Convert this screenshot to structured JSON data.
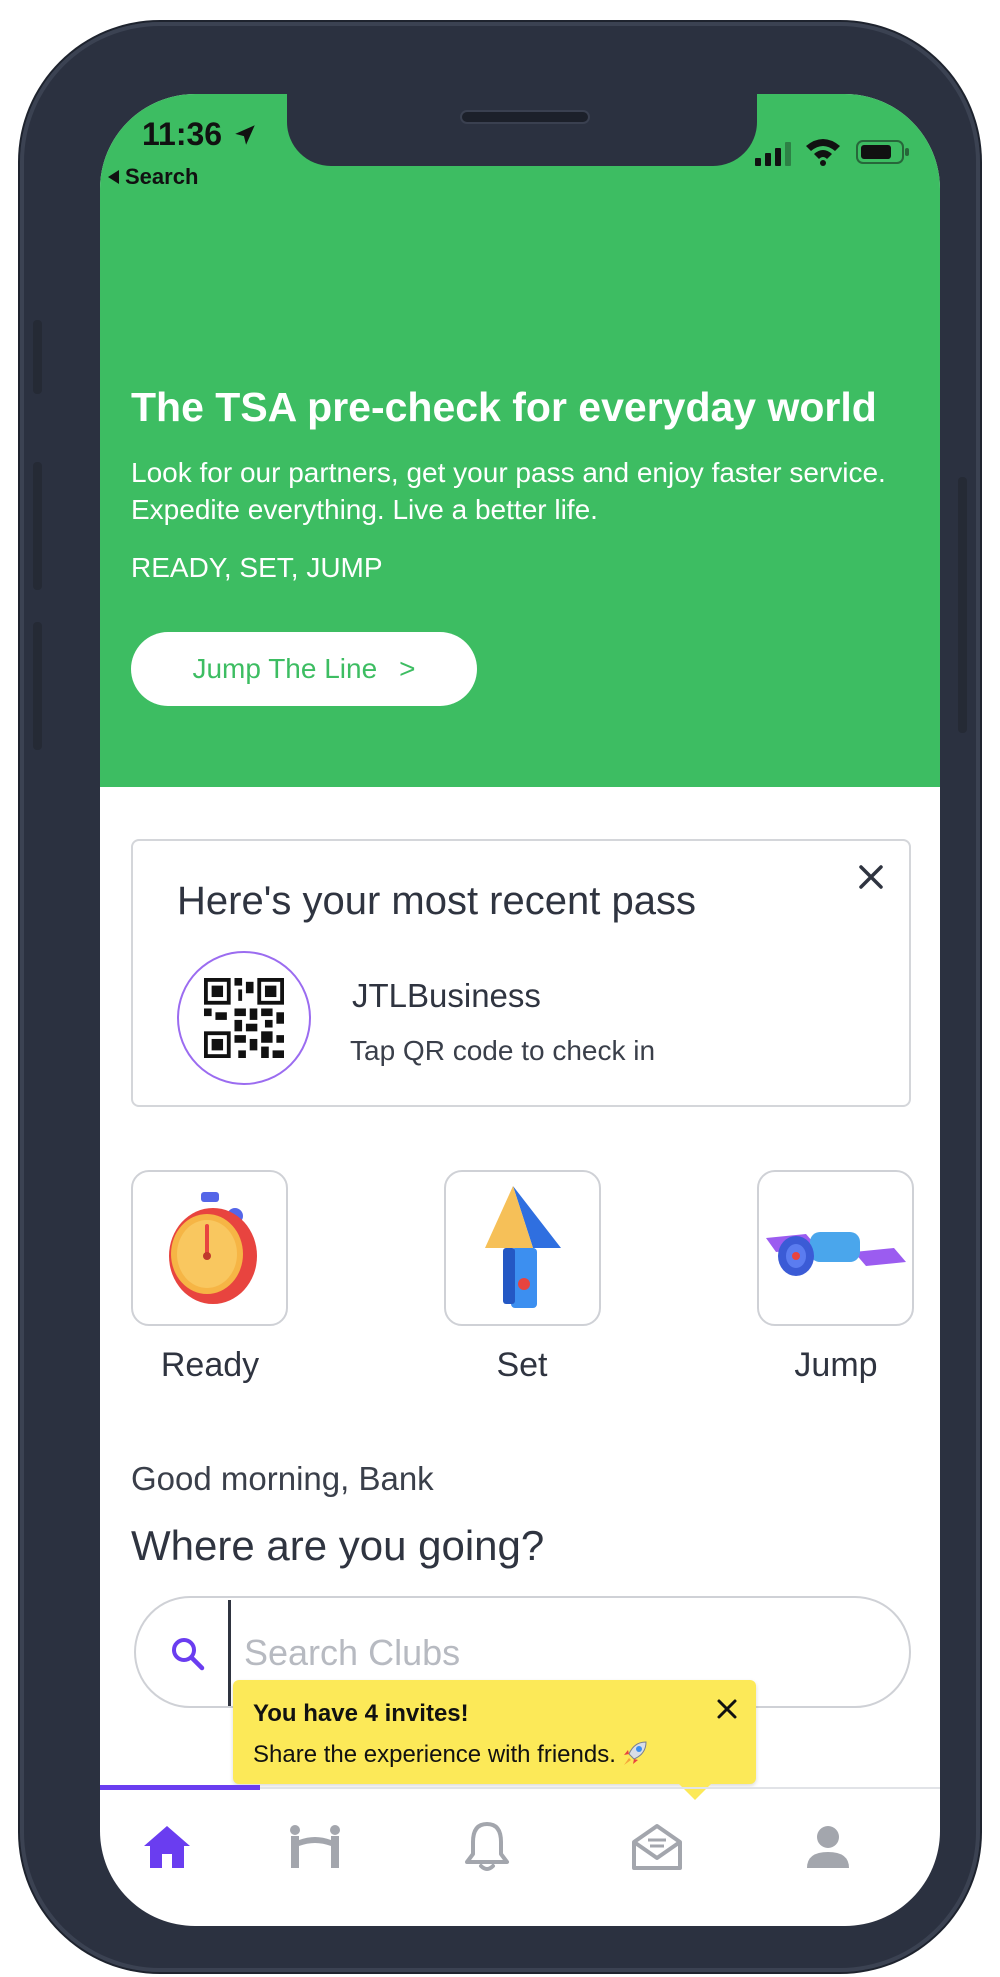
{
  "status_bar": {
    "time": "11:36",
    "back_label": "Search"
  },
  "hero": {
    "title": "The TSA pre-check for everyday world",
    "description": "Look for our partners, get your pass and enjoy faster service. Expedite everything. Live a better life.",
    "tagline": "READY, SET, JUMP",
    "cta_label": "Jump The Line",
    "cta_chevron": ">",
    "background_color": "#3dbd62"
  },
  "recent_pass": {
    "heading": "Here's your most recent pass",
    "name": "JTLBusiness",
    "instruction": "Tap QR code to check in"
  },
  "steps": [
    {
      "label": "Ready",
      "icon": "stopwatch-icon"
    },
    {
      "label": "Set",
      "icon": "arrow-up-icon"
    },
    {
      "label": "Jump",
      "icon": "satellite-icon"
    }
  ],
  "greeting": "Good morning, Bank",
  "question": "Where are you going?",
  "search": {
    "placeholder": "Search Clubs"
  },
  "invite_tooltip": {
    "title": "You have 4 invites!",
    "text": "Share the experience with friends."
  },
  "tab_bar": {
    "items": [
      "home-icon",
      "clubs-icon",
      "bell-icon",
      "mail-icon",
      "profile-icon"
    ],
    "active_color": "#6a3df0",
    "inactive_color": "#a3a6ad"
  }
}
